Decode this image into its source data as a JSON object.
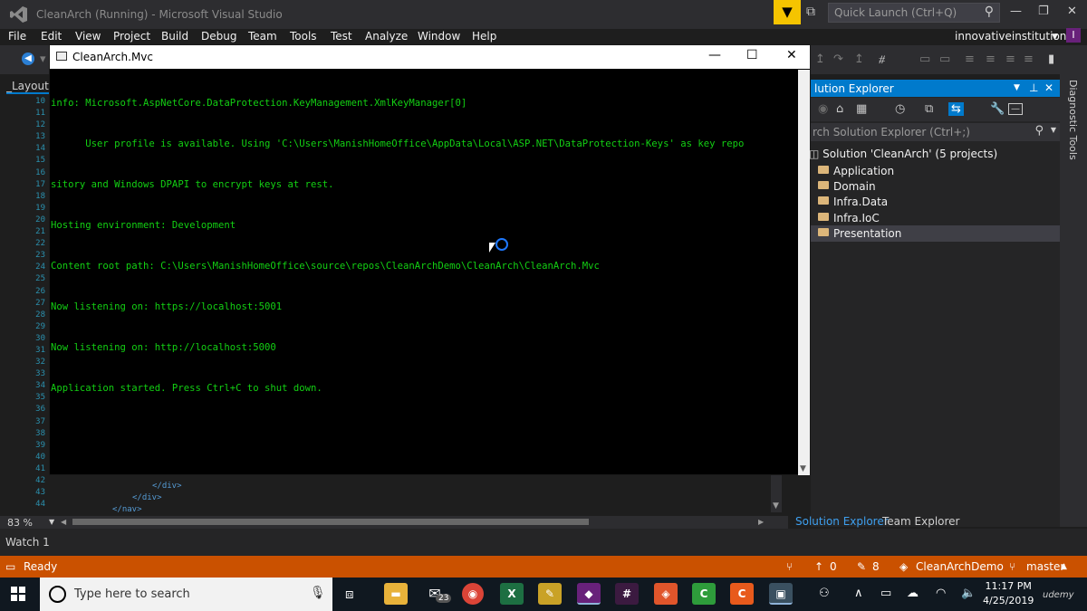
{
  "window": {
    "title": "CleanArch (Running) - Microsoft Visual Studio"
  },
  "quick_launch": {
    "placeholder": "Quick Launch (Ctrl+Q)"
  },
  "account": {
    "name": "innovativeinstitution",
    "initial": "I"
  },
  "menu": [
    "File",
    "Edit",
    "View",
    "Project",
    "Build",
    "Debug",
    "Team",
    "Tools",
    "Test",
    "Analyze",
    "Window",
    "Help"
  ],
  "editor": {
    "tab_label": "_Layout.c",
    "line_numbers": [
      "10",
      "11",
      "12",
      "13",
      "14",
      "15",
      "16",
      "17",
      "18",
      "19",
      "20",
      "21",
      "22",
      "23",
      "24",
      "25",
      "26",
      "27",
      "28",
      "29",
      "30",
      "31",
      "32",
      "33",
      "34",
      "35",
      "36",
      "37",
      "38",
      "39",
      "40",
      "41",
      "42",
      "43",
      "44"
    ],
    "code_lines": [
      "</div>",
      "</div>",
      "</nav>"
    ],
    "zoom": "83 %"
  },
  "console": {
    "title": "CleanArch.Mvc",
    "lines": [
      "info: Microsoft.AspNetCore.DataProtection.KeyManagement.XmlKeyManager[0]",
      "      User profile is available. Using 'C:\\Users\\ManishHomeOffice\\AppData\\Local\\ASP.NET\\DataProtection-Keys' as key repo",
      "sitory and Windows DPAPI to encrypt keys at rest.",
      "Hosting environment: Development",
      "Content root path: C:\\Users\\ManishHomeOffice\\source\\repos\\CleanArchDemo\\CleanArch\\CleanArch.Mvc",
      "Now listening on: https://localhost:5001",
      "Now listening on: http://localhost:5000",
      "Application started. Press Ctrl+C to shut down."
    ]
  },
  "solution_explorer": {
    "title": "lution Explorer",
    "search_placeholder": "rch Solution Explorer (Ctrl+;)",
    "root": "Solution 'CleanArch' (5 projects)",
    "items": [
      "Application",
      "Domain",
      "Infra.Data",
      "Infra.IoC",
      "Presentation"
    ],
    "selected": "Presentation",
    "tabs": [
      "Solution Explorer",
      "Team Explorer"
    ]
  },
  "right_rail": {
    "label": "Diagnostic Tools"
  },
  "watch": {
    "label": "Watch 1"
  },
  "status": {
    "text": "Ready",
    "up_count": "0",
    "pending_count": "8",
    "repo": "CleanArchDemo",
    "branch": "master"
  },
  "taskbar": {
    "search_placeholder": "Type here to search",
    "mail_badge": "23",
    "time": "11:17 PM",
    "date": "4/25/2019"
  },
  "colors": {
    "accent": "#007acc",
    "status_bar": "#ca5100",
    "console_text": "#13d013",
    "quick_filter": "#f5c400"
  }
}
